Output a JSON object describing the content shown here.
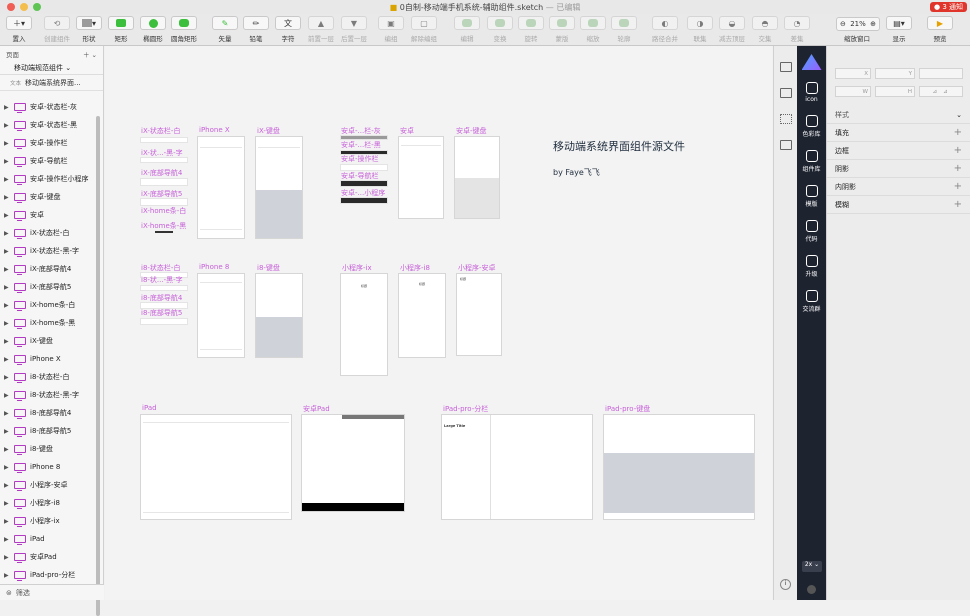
{
  "window": {
    "title": "0自制-移动端手机系统-辅助组件.sketch",
    "title_suffix": "— 已编辑",
    "notification": "● 3 通知"
  },
  "toolbar": {
    "items": [
      {
        "label": "置入",
        "icon": "plus-icon",
        "enabled": true
      },
      {
        "label": "创建组件",
        "icon": "symbol-icon",
        "enabled": false
      },
      {
        "label": "形状",
        "icon": "shape-icon",
        "enabled": true
      },
      {
        "label": "矩形",
        "icon": "rectangle-icon",
        "enabled": true
      },
      {
        "label": "椭圆形",
        "icon": "oval-icon",
        "enabled": true
      },
      {
        "label": "圆角矩形",
        "icon": "rounded-rectangle-icon",
        "enabled": true
      },
      {
        "label": "矢量",
        "icon": "vector-icon",
        "enabled": true
      },
      {
        "label": "铅笔",
        "icon": "pencil-icon",
        "enabled": true
      },
      {
        "label": "字符",
        "icon": "text-icon",
        "enabled": true
      },
      {
        "label": "前置一层",
        "icon": "forward-icon",
        "enabled": false
      },
      {
        "label": "后置一层",
        "icon": "backward-icon",
        "enabled": false
      },
      {
        "label": "编组",
        "icon": "group-icon",
        "enabled": false
      },
      {
        "label": "解除编组",
        "icon": "ungroup-icon",
        "enabled": false
      },
      {
        "label": "编辑",
        "icon": "edit-icon",
        "enabled": false
      },
      {
        "label": "变换",
        "icon": "transform-icon",
        "enabled": false
      },
      {
        "label": "旋转",
        "icon": "rotate-icon",
        "enabled": false
      },
      {
        "label": "蒙版",
        "icon": "mask-icon",
        "enabled": false
      },
      {
        "label": "缩放",
        "icon": "scale-icon",
        "enabled": false
      },
      {
        "label": "轮廓",
        "icon": "outline-icon",
        "enabled": false
      },
      {
        "label": "路径合并",
        "icon": "union-icon",
        "enabled": false
      },
      {
        "label": "联集",
        "icon": "union-icon",
        "enabled": false
      },
      {
        "label": "减去顶层",
        "icon": "subtract-icon",
        "enabled": false
      },
      {
        "label": "交集",
        "icon": "intersect-icon",
        "enabled": false
      },
      {
        "label": "差集",
        "icon": "difference-icon",
        "enabled": false
      },
      {
        "label": "缩放窗口",
        "icon": "zoom-icon",
        "enabled": true
      },
      {
        "label": "显示",
        "icon": "view-icon",
        "enabled": true
      },
      {
        "label": "预览",
        "icon": "play-icon",
        "enabled": true
      }
    ],
    "zoom": "21%"
  },
  "left_panel": {
    "pages_label": "页面",
    "current_page": "移动端规范组件 ⌄",
    "text_layer_tag": "文本",
    "text_layer": "移动端系统界面...",
    "artboards": [
      "安卓-状态栏-灰",
      "安卓-状态栏-黑",
      "安卓-操作栏",
      "安卓-导航栏",
      "安卓-操作栏小程序",
      "安卓-键盘",
      "安卓",
      "iX-状态栏-白",
      "iX-状态栏-黑-字",
      "iX-底部导航4",
      "iX-底部导航5",
      "iX-home条-白",
      "iX-home条-黑",
      "iX-键盘",
      "iPhone X",
      "i8-状态栏-白",
      "i8-状态栏-黑-字",
      "i8-底部导航4",
      "i8-底部导航5",
      "i8-键盘",
      "iPhone 8",
      "小程序-安卓",
      "小程序-i8",
      "小程序-ix",
      "iPad",
      "安卓Pad",
      "iPad-pro-分栏"
    ],
    "filter_label": "筛选"
  },
  "canvas": {
    "doc_title": "移动端系统界面组件源文件",
    "doc_author": "by  Faye飞飞",
    "labels": {
      "ix_status_white": "iX-状态栏-白",
      "ix_status_black": "iX-状...-黑-字",
      "ix_nav4": "iX-底部导航4",
      "ix_nav5": "iX-底部导航5",
      "ix_home_white": "iX-home条-白",
      "ix_home_black": "iX-home条-黑",
      "iphonex": "iPhone X",
      "ix_kb": "iX-键盘",
      "an_status_gray": "安卓-...栏-灰",
      "an_status_black": "安卓-...栏-黑",
      "an_actionbar": "安卓-操作栏",
      "an_navbar": "安卓-导航栏",
      "an_mini": "安卓-...小程序",
      "android": "安卓",
      "an_kb": "安卓-键盘",
      "i8_status_white": "i8-状态栏-白",
      "i8_status_black": "i8-状...-黑-字",
      "i8_nav4": "i8-底部导航4",
      "i8_nav5": "i8-底部导航5",
      "iphone8": "iPhone 8",
      "i8_kb": "i8-键盘",
      "mini_ix": "小程序-ix",
      "mini_i8": "小程序-i8",
      "mini_an": "小程序-安卓",
      "ipad": "iPad",
      "anpad": "安卓Pad",
      "ipad_split": "iPad-pro-分栏",
      "ipad_kb": "iPad-pro-键盘",
      "large_title": "Large Title",
      "mini_title": "标题"
    }
  },
  "plugin": {
    "items": [
      "icon",
      "色彩库",
      "组件库",
      "模版",
      "代码",
      "升级",
      "交流群"
    ],
    "scale": "2x ⌄"
  },
  "inspector": {
    "style_label": "样式",
    "sections": [
      "填充",
      "边框",
      "阴影",
      "内阴影",
      "模糊"
    ],
    "fields": [
      "X",
      "Y",
      "W",
      "H"
    ]
  }
}
